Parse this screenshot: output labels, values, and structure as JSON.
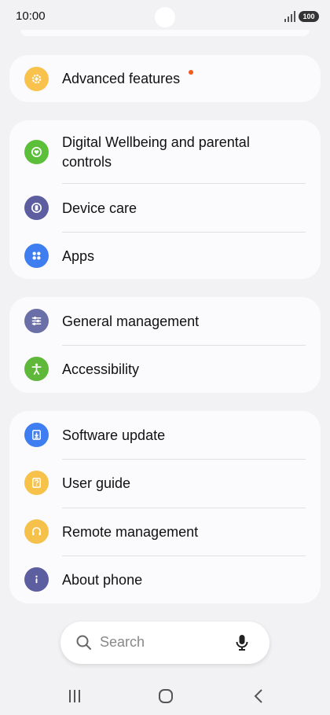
{
  "status": {
    "time": "10:00",
    "battery": "100"
  },
  "colors": {
    "advanced": "#f8c24c",
    "wellbeing": "#5bbf3a",
    "device_care": "#5c5e9f",
    "apps": "#3e7ef0",
    "general": "#6b6fa8",
    "accessibility": "#5fb83a",
    "software": "#3e7ef0",
    "guide": "#f7c24a",
    "remote": "#f5c14a",
    "about": "#5c5e9f",
    "notification_dot": "#f25c1c"
  },
  "settings": {
    "advanced": {
      "label": "Advanced features",
      "icon": "gear-plus-icon"
    },
    "wellbeing": {
      "label_line1": "Digital Wellbeing and parental",
      "label_line2": "controls",
      "icon": "heart-circle-icon"
    },
    "device_care": {
      "label": "Device care",
      "icon": "device-care-icon"
    },
    "apps": {
      "label": "Apps",
      "icon": "apps-grid-icon"
    },
    "general": {
      "label": "General management",
      "icon": "sliders-icon"
    },
    "accessibility": {
      "label": "Accessibility",
      "icon": "accessibility-person-icon"
    },
    "software": {
      "label": "Software update",
      "icon": "download-icon"
    },
    "guide": {
      "label": "User guide",
      "icon": "question-book-icon"
    },
    "remote": {
      "label": "Remote management",
      "icon": "headset-icon"
    },
    "about": {
      "label": "About phone",
      "icon": "info-icon"
    }
  },
  "search": {
    "placeholder": "Search"
  }
}
